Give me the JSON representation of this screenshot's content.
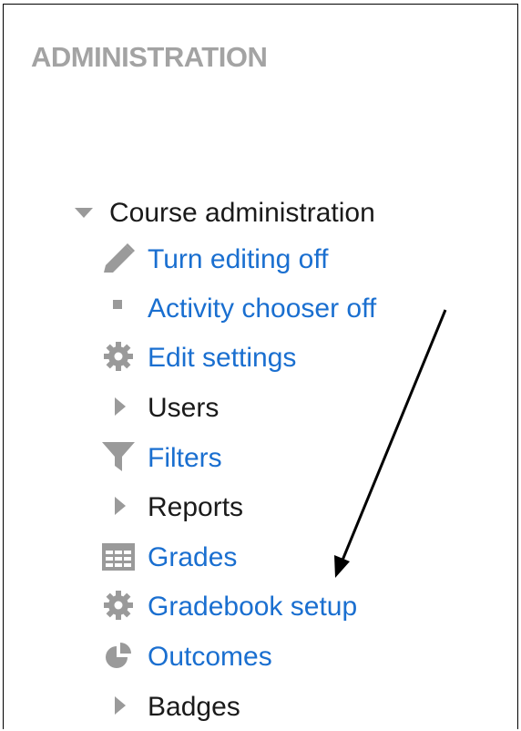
{
  "block": {
    "title": "ADMINISTRATION"
  },
  "tree": {
    "root": {
      "label": "Course administration",
      "icon": "triangle-down-icon",
      "expanded": true
    },
    "items": [
      {
        "label": "Turn editing off",
        "icon": "pencil-icon",
        "type": "link"
      },
      {
        "label": "Activity chooser off",
        "icon": "square-bullet-icon",
        "type": "link"
      },
      {
        "label": "Edit settings",
        "icon": "gear-icon",
        "type": "link"
      },
      {
        "label": "Users",
        "icon": "triangle-right-icon",
        "type": "branch"
      },
      {
        "label": "Filters",
        "icon": "filter-icon",
        "type": "link"
      },
      {
        "label": "Reports",
        "icon": "triangle-right-icon",
        "type": "branch"
      },
      {
        "label": "Grades",
        "icon": "table-icon",
        "type": "link"
      },
      {
        "label": "Gradebook setup",
        "icon": "gear-icon",
        "type": "link"
      },
      {
        "label": "Outcomes",
        "icon": "pie-chart-icon",
        "type": "link"
      },
      {
        "label": "Badges",
        "icon": "triangle-right-icon",
        "type": "branch"
      }
    ]
  },
  "colors": {
    "link": "#1a6fd0",
    "text": "#1a1a1a",
    "title": "#a3a3a3",
    "icon": "#9a9a9a",
    "annotation_arrow": "#000000"
  }
}
